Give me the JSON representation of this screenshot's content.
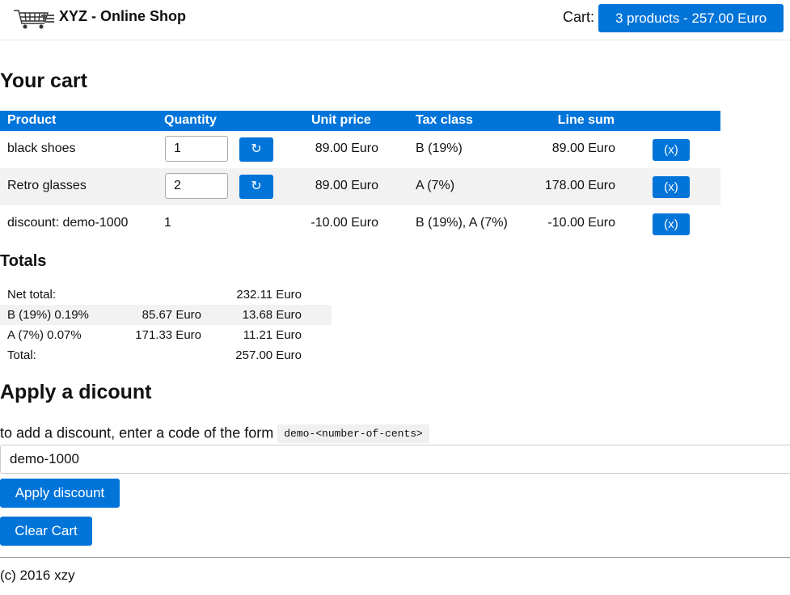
{
  "header": {
    "shop_title": "XYZ - Online Shop",
    "cart_label": "Cart:",
    "cart_summary": "3 products - 257.00 Euro",
    "logo_icon": "shopping-cart-icon"
  },
  "cart": {
    "heading": "Your cart",
    "columns": [
      "Product",
      "Quantity",
      "Unit price",
      "Tax class",
      "Line sum"
    ],
    "rows": [
      {
        "product": "black shoes",
        "quantity": "1",
        "unit_price": "89.00 Euro",
        "tax_class": "B (19%)",
        "line_sum": "89.00 Euro",
        "refresh": "↻",
        "remove": "(x)"
      },
      {
        "product": "Retro glasses",
        "quantity": "2",
        "unit_price": "89.00 Euro",
        "tax_class": "A (7%)",
        "line_sum": "178.00 Euro",
        "refresh": "↻",
        "remove": "(x)"
      },
      {
        "product": "discount: demo-1000",
        "quantity": "1",
        "unit_price": "-10.00 Euro",
        "tax_class": "B (19%), A (7%)",
        "line_sum": "-10.00 Euro",
        "remove": "(x)"
      }
    ]
  },
  "totals": {
    "heading": "Totals",
    "net_label": "Net total:",
    "net_value": "232.11 Euro",
    "tax_rows": [
      {
        "label": "B (19%) 0.19%",
        "base": "85.67 Euro",
        "tax": "13.68 Euro"
      },
      {
        "label": "A (7%) 0.07%",
        "base": "171.33 Euro",
        "tax": "11.21 Euro"
      }
    ],
    "total_label": "Total:",
    "total_value": "257.00 Euro"
  },
  "discount": {
    "heading": "Apply a dicount",
    "hint": "to add a discount, enter a code of the form",
    "code_format": "demo-<number-of-cents>",
    "input_value": "demo-1000",
    "apply_label": "Apply discount",
    "clear_label": "Clear Cart"
  },
  "footer": {
    "text": "(c) 2016 xzy"
  },
  "colors": {
    "accent": "#0074d9",
    "row_alt": "#f2f2f2"
  }
}
